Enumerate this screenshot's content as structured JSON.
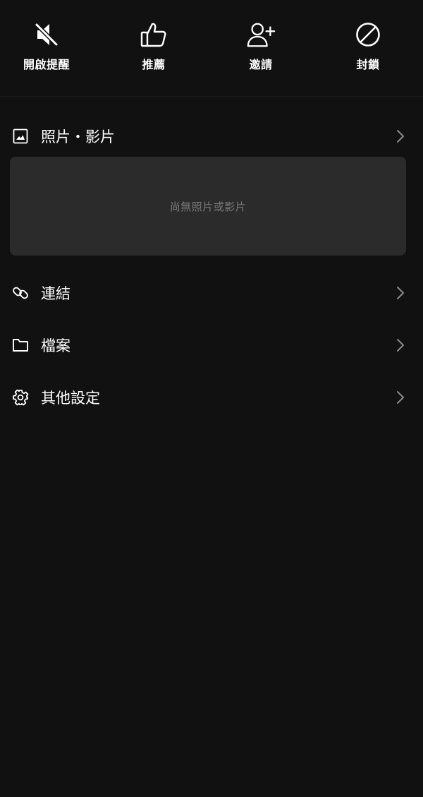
{
  "top_actions": [
    {
      "label": "開啟提醒",
      "icon": "speaker-muted-icon"
    },
    {
      "label": "推薦",
      "icon": "thumbs-up-icon"
    },
    {
      "label": "邀請",
      "icon": "add-user-icon"
    },
    {
      "label": "封鎖",
      "icon": "block-icon"
    }
  ],
  "sections": {
    "media": {
      "label": "照片・影片",
      "icon": "image-icon",
      "empty_text": "尚無照片或影片"
    },
    "links": {
      "label": "連結",
      "icon": "link-icon"
    },
    "files": {
      "label": "檔案",
      "icon": "folder-icon"
    },
    "settings": {
      "label": "其他設定",
      "icon": "gear-icon"
    }
  },
  "colors": {
    "background": "#111111",
    "panel": "#2b2b2b",
    "text": "#ffffff",
    "muted_text": "#7a7a7a",
    "chevron": "#8a8a8a"
  }
}
